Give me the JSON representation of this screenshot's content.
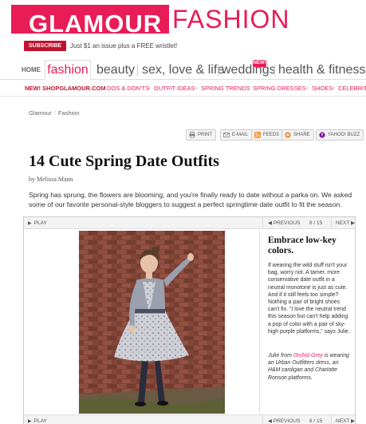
{
  "header": {
    "logo": "GLAMOUR",
    "section_title": "FASHION",
    "subscribe_label": "SUBSCRIBE",
    "subscribe_offer": "Just $1 an issue plus a FREE wristlet!"
  },
  "mainnav": {
    "home": "HOME",
    "items": [
      "fashion",
      "beauty",
      "sex, love & life",
      "weddings",
      "health & fitness +"
    ],
    "new_badge": "NEW!"
  },
  "subnav": {
    "items": [
      "NEW! SHOPGLAMOUR.COM",
      "DOS & DON'TS",
      "OUTFIT IDEAS",
      "SPRING TRENDS",
      "SPRING DRESSES",
      "SHOES",
      "CELEBRITY"
    ]
  },
  "breadcrumb": {
    "items": [
      "Glamour",
      "Fashion"
    ],
    "separator": "/"
  },
  "toolbar": {
    "print": "PRINT",
    "email": "E-MAIL",
    "feeds": "FEEDS",
    "share": "SHARE",
    "buzz": "YAHOO! BUZZ"
  },
  "article": {
    "title": "14 Cute Spring Date Outfits",
    "byline": "by Melissa Mann",
    "intro": "Spring has sprung, the flowers are blooming, and you're finally ready to date without a parka on. We asked some of our favorite personal-style bloggers to suggest a perfect springtime date outfit to fit the season."
  },
  "slideshow": {
    "play_label": "PLAY",
    "prev_label": "PREVIOUS",
    "next_label": "NEXT",
    "current": 8,
    "total": 15,
    "counter": "8 / 15",
    "caption_title": "Embrace low-key colors.",
    "caption_body": "If wearing the wild stuff isn't your bag, worry not. A tamer, more conservative date outfit in a neutral monotone is just as cute. And if it still feels too simple? Nothing a pair of bright shoes can't fix. \"I love the neutral trend this season but can't help adding a pop of color with a pair of sky-high purple platforms,\" says Julie.",
    "credit_prefix": "Julie from ",
    "credit_link": "Orchid Grey",
    "credit_suffix": " is wearing an Urban Outfitters dress, an H&M cardigan and Charlotte Ronson platforms."
  },
  "colors": {
    "brand_pink": "#e81c57",
    "subscribe_red": "#c0122f",
    "brick": "#8a4a3c"
  }
}
